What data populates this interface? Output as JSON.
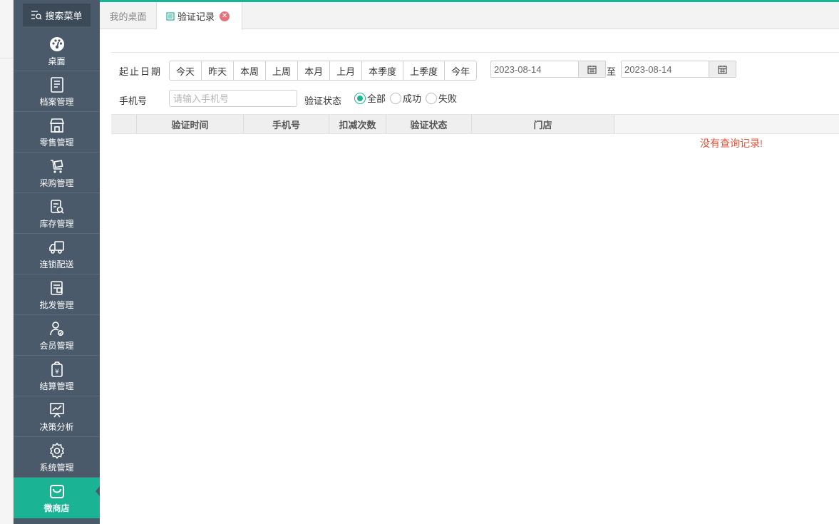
{
  "sidebar": {
    "search_label": "搜索菜单",
    "items": [
      {
        "label": "桌面",
        "icon": "dashboard-icon"
      },
      {
        "label": "档案管理",
        "icon": "archive-icon"
      },
      {
        "label": "零售管理",
        "icon": "store-icon"
      },
      {
        "label": "采购管理",
        "icon": "cart-icon"
      },
      {
        "label": "库存管理",
        "icon": "inventory-icon"
      },
      {
        "label": "连锁配送",
        "icon": "truck-icon"
      },
      {
        "label": "批发管理",
        "icon": "wholesale-icon"
      },
      {
        "label": "会员管理",
        "icon": "member-icon"
      },
      {
        "label": "结算管理",
        "icon": "settlement-icon"
      },
      {
        "label": "决策分析",
        "icon": "chart-icon"
      },
      {
        "label": "系统管理",
        "icon": "gear-icon"
      },
      {
        "label": "微商店",
        "icon": "bag-icon"
      }
    ],
    "active_item": "微商店"
  },
  "tabs": {
    "home_label": "我的桌面",
    "active_label": "验证记录"
  },
  "filters": {
    "date_label": "起止日期",
    "quick_buttons": [
      "今天",
      "昨天",
      "本周",
      "上周",
      "本月",
      "上月",
      "本季度",
      "上季度",
      "今年"
    ],
    "start_date": "2023-08-14",
    "to_label": "至",
    "end_date": "2023-08-14",
    "phone_label": "手机号",
    "phone_placeholder": "请输入手机号",
    "status_label": "验证状态",
    "status_options": [
      "全部",
      "成功",
      "失败"
    ],
    "status_selected": "全部"
  },
  "table": {
    "columns": [
      "验证时间",
      "手机号",
      "扣减次数",
      "验证状态",
      "门店"
    ],
    "empty_message": "没有查询记录!"
  },
  "colors": {
    "accent": "#1ab394",
    "sidebar_bg": "#4a5a6a",
    "empty_text": "#e8543c"
  }
}
